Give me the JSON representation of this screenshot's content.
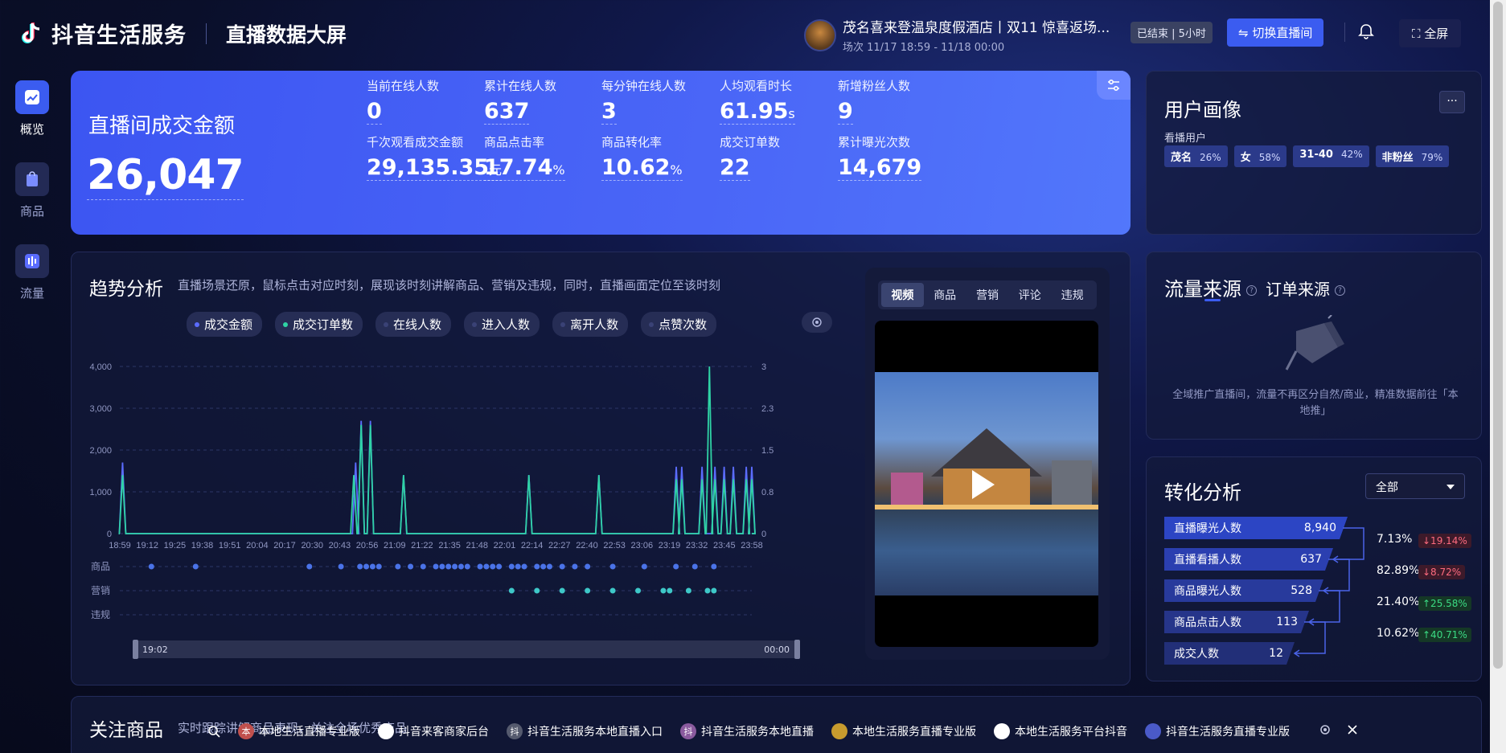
{
  "header": {
    "logo_text": "抖音生活服务",
    "page_title": "直播数据大屏",
    "room_title": "茂名喜来登温泉度假酒店丨双11 惊喜返场...",
    "room_time": "场次 11/17 18:59 - 11/18 00:00",
    "status": "已结束 | 5小时",
    "switch_label": "切换直播间",
    "fullscreen_label": "全屏"
  },
  "sidenav": {
    "items": [
      {
        "label": "概览",
        "icon": "chart-icon",
        "active": true
      },
      {
        "label": "商品",
        "icon": "bag-icon",
        "active": false
      },
      {
        "label": "流量",
        "icon": "bars-icon",
        "active": false
      }
    ]
  },
  "kpi": {
    "main_label": "直播间成交金额",
    "main_value": "26,047",
    "cells": [
      {
        "label": "当前在线人数",
        "value": "0",
        "unit": ""
      },
      {
        "label": "累计在线人数",
        "value": "637",
        "unit": ""
      },
      {
        "label": "每分钟在线人数",
        "value": "3",
        "unit": ""
      },
      {
        "label": "人均观看时长",
        "value": "61.95",
        "unit": "s"
      },
      {
        "label": "新增粉丝人数",
        "value": "9",
        "unit": ""
      },
      {
        "label": "千次观看成交金额",
        "value": "29,135.35",
        "unit": "元"
      },
      {
        "label": "商品点击率",
        "value": "17.74",
        "unit": "%"
      },
      {
        "label": "商品转化率",
        "value": "10.62",
        "unit": "%"
      },
      {
        "label": "成交订单数",
        "value": "22",
        "unit": ""
      },
      {
        "label": "累计曝光次数",
        "value": "14,679",
        "unit": ""
      }
    ]
  },
  "trend": {
    "title": "趋势分析",
    "description": "直播场景还原，鼠标点击对应时刻，展现该时刻讲解商品、营销及违规，同时，直播画面定位至该时刻",
    "legend": [
      {
        "label": "成交金额",
        "color": "#5b6cff",
        "active": true
      },
      {
        "label": "成交订单数",
        "color": "#2fd3a5",
        "active": true
      },
      {
        "label": "在线人数",
        "color": "#3a4276",
        "active": false
      },
      {
        "label": "进入人数",
        "color": "#3a4276",
        "active": false
      },
      {
        "label": "离开人数",
        "color": "#3a4276",
        "active": false
      },
      {
        "label": "点赞次数",
        "color": "#3a4276",
        "active": false
      }
    ],
    "row_labels": [
      "商品",
      "营销",
      "违规"
    ],
    "range_start": "19:02",
    "range_end": "00:00"
  },
  "chart_data": {
    "type": "line",
    "x_ticks": [
      "18:59",
      "19:12",
      "19:25",
      "19:38",
      "19:51",
      "20:04",
      "20:17",
      "20:30",
      "20:43",
      "20:56",
      "21:09",
      "21:22",
      "21:35",
      "21:48",
      "22:01",
      "22:14",
      "22:27",
      "22:40",
      "22:53",
      "23:06",
      "23:19",
      "23:32",
      "23:45",
      "23:58"
    ],
    "y_left_ticks": [
      "4,000",
      "3,000",
      "2,000",
      "1,000",
      "0"
    ],
    "y_right_ticks": [
      "3",
      "2.3",
      "1.5",
      "0.8",
      "0"
    ],
    "ylim_left": [
      0,
      4000
    ],
    "ylim_right": [
      0,
      3
    ],
    "series": [
      {
        "color": "#5b6cff",
        "axis": "left",
        "points": [
          [
            1.5,
            1700
          ],
          [
            128,
            1700
          ],
          [
            131,
            2700
          ],
          [
            136,
            2700
          ],
          [
            154,
            1400
          ],
          [
            222,
            1400
          ],
          [
            260,
            1400
          ],
          [
            302,
            1600
          ],
          [
            305,
            1600
          ],
          [
            316,
            1600
          ],
          [
            323,
            1600
          ],
          [
            328,
            1600
          ],
          [
            333,
            1600
          ],
          [
            340,
            1600
          ],
          [
            343,
            1600
          ]
        ]
      },
      {
        "color": "#2fd3a5",
        "axis": "left",
        "points": [
          [
            1.5,
            1400
          ],
          [
            127,
            1400
          ],
          [
            131,
            2600
          ],
          [
            136,
            2600
          ],
          [
            154,
            1400
          ],
          [
            222,
            1400
          ],
          [
            260,
            1400
          ],
          [
            302,
            1300
          ],
          [
            305,
            1300
          ],
          [
            316,
            1300
          ],
          [
            320,
            4000
          ],
          [
            323,
            1300
          ],
          [
            328,
            1300
          ],
          [
            333,
            1300
          ],
          [
            340,
            1300
          ],
          [
            343,
            1300
          ]
        ]
      }
    ]
  },
  "video": {
    "tabs": [
      "视频",
      "商品",
      "营销",
      "评论",
      "违规"
    ],
    "active_tab": "视频"
  },
  "persona": {
    "title": "用户画像",
    "sub_label": "看播用户",
    "tags": [
      {
        "name": "茂名",
        "pct": "26%"
      },
      {
        "name": "女",
        "pct": "58%"
      },
      {
        "name": "31-40",
        "pct": "42%"
      },
      {
        "name": "非粉丝",
        "pct": "79%"
      }
    ]
  },
  "traffic": {
    "title": "流量来源",
    "order_title": "订单来源",
    "empty_text": "全域推广直播间，流量不再区分自然/商业，精准数据前往「本地推」"
  },
  "conversion": {
    "title": "转化分析",
    "select_value": "全部",
    "rows": [
      {
        "label": "直播曝光人数",
        "value": "8,940"
      },
      {
        "label": "直播看播人数",
        "value": "637"
      },
      {
        "label": "商品曝光人数",
        "value": "528"
      },
      {
        "label": "商品点击人数",
        "value": "113"
      },
      {
        "label": "成交人数",
        "value": "12"
      }
    ],
    "rates": [
      {
        "rate": "7.13%",
        "delta": "↓19.14%",
        "dir": "down"
      },
      {
        "rate": "82.89%",
        "delta": "↓8.72%",
        "dir": "down"
      },
      {
        "rate": "21.40%",
        "delta": "↑25.58%",
        "dir": "up"
      },
      {
        "rate": "10.62%",
        "delta": "↑40.71%",
        "dir": "up"
      }
    ]
  },
  "focus": {
    "title": "关注商品",
    "description": "实时跟踪讲解商品表现，关注全场优秀商品"
  },
  "bookmarks": [
    {
      "label": "本地生活直播专业版",
      "icon_text": "本",
      "color": "#c0504d"
    },
    {
      "label": "抖音来客商家后台",
      "icon_text": "",
      "color": "#ffffff"
    },
    {
      "label": "抖音生活服务本地直播入口",
      "icon_text": "抖",
      "color": "#555a6e"
    },
    {
      "label": "抖音生活服务本地直播",
      "icon_text": "抖",
      "color": "#8a5a9e"
    },
    {
      "label": "本地生活服务直播专业版",
      "icon_text": "",
      "color": "#c89b2e"
    },
    {
      "label": "本地生活服务平台抖音",
      "icon_text": "",
      "color": "#ffffff"
    },
    {
      "label": "抖音生活服务直播专业版",
      "icon_text": "",
      "color": "#4a5ac8"
    }
  ]
}
